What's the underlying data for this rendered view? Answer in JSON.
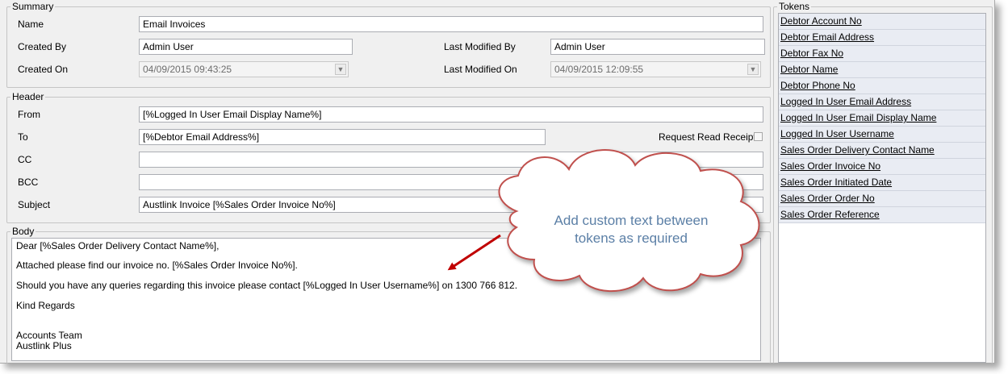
{
  "summary": {
    "legend": "Summary",
    "name_label": "Name",
    "name_value": "Email Invoices",
    "created_by_label": "Created By",
    "created_by_value": "Admin User",
    "last_modified_by_label": "Last Modified By",
    "last_modified_by_value": "Admin User",
    "created_on_label": "Created On",
    "created_on_value": "04/09/2015 09:43:25",
    "last_modified_on_label": "Last Modified On",
    "last_modified_on_value": "04/09/2015 12:09:55"
  },
  "header": {
    "legend": "Header",
    "from_label": "From",
    "from_value": "[%Logged In User Email Display Name%]",
    "to_label": "To",
    "to_value": "[%Debtor Email Address%]",
    "read_receipt_label": "Request Read Receipt",
    "cc_label": "CC",
    "cc_value": "",
    "bcc_label": "BCC",
    "bcc_value": "",
    "subject_label": "Subject",
    "subject_value": "Austlink Invoice [%Sales Order Invoice No%]"
  },
  "body": {
    "legend": "Body",
    "lines": [
      "Dear [%Sales Order Delivery Contact Name%],",
      "Attached please find our invoice no. [%Sales Order Invoice No%].",
      "Should you have any queries regarding this invoice please contact [%Logged In User Username%] on 1300 766 812.",
      "Kind Regards",
      "Accounts Team",
      "Austlink Plus"
    ]
  },
  "tokens": {
    "legend": "Tokens",
    "items": [
      "Debtor Account No",
      "Debtor Email Address",
      "Debtor Fax No",
      "Debtor Name",
      "Debtor Phone No",
      "Logged In User Email Address",
      "Logged In User Email Display Name",
      "Logged In User Username",
      "Sales Order Delivery Contact Name",
      "Sales Order Invoice No",
      "Sales Order Initiated Date",
      "Sales Order Order No",
      "Sales Order Reference"
    ]
  },
  "callout": {
    "line1": "Add custom text between",
    "line2": "tokens as required"
  },
  "colors": {
    "window_bg": "#f0f0f0",
    "token_bg": "#e9ecf3",
    "callout_fill": "#ffffff",
    "callout_border": "#c0504d",
    "callout_text": "#5b7fa6",
    "arrow": "#c00000"
  }
}
